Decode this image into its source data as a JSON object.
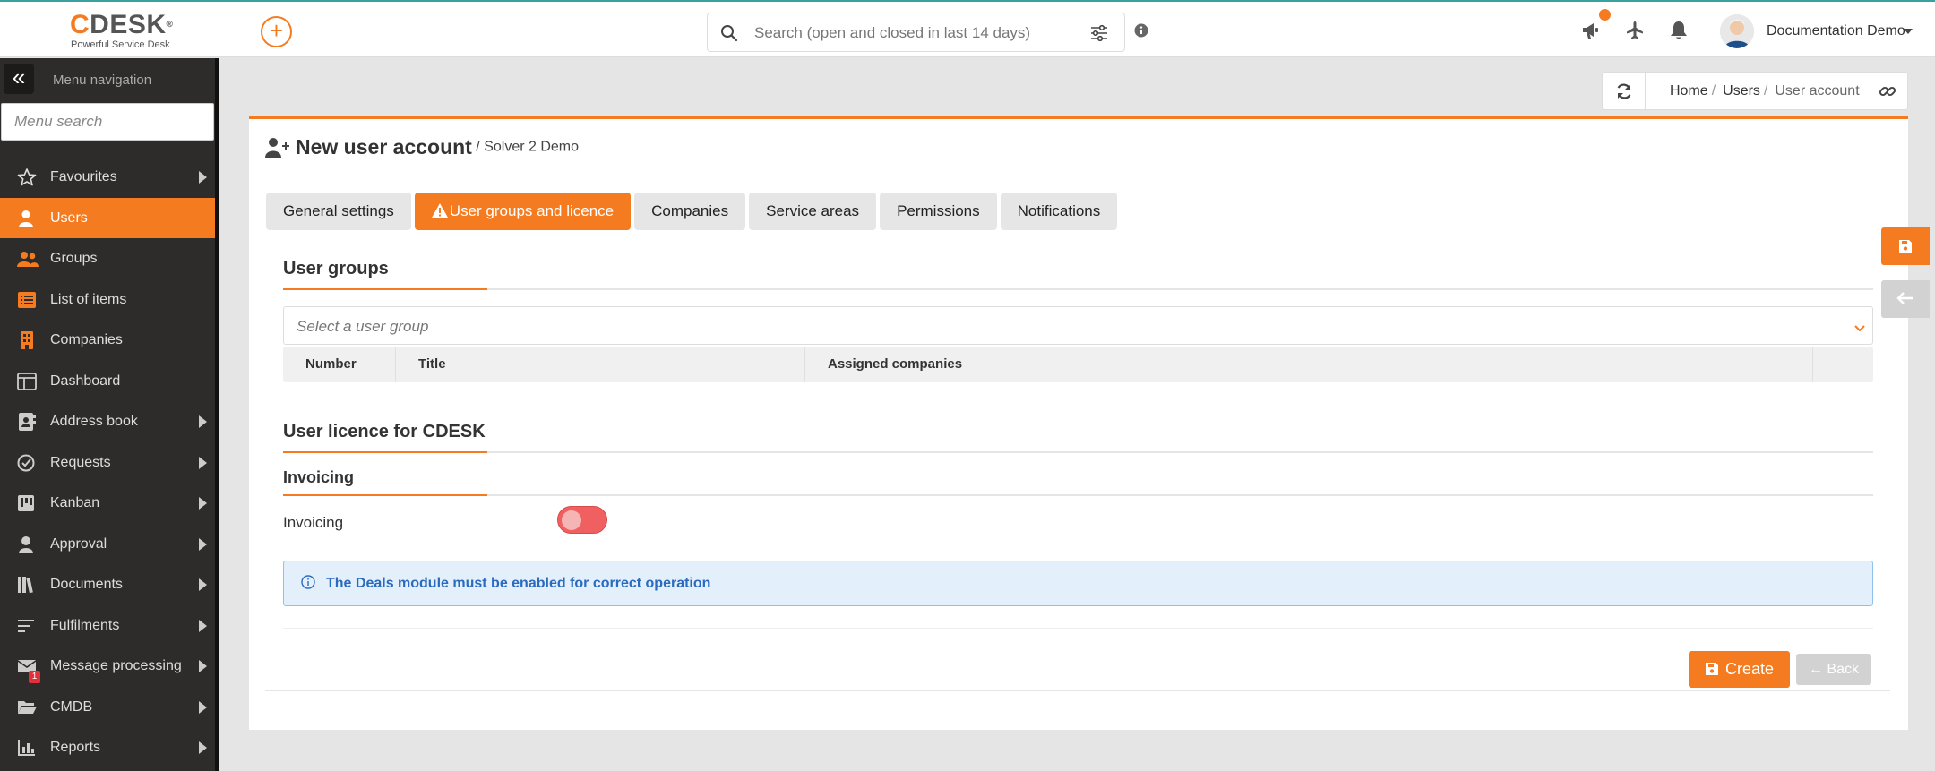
{
  "header": {
    "logo_first": "C",
    "logo_rest": "DESK",
    "logo_mark": "®",
    "logo_tagline": "Powerful Service Desk",
    "add_label": "+",
    "search_placeholder": "Search (open and closed in last 14 days)",
    "user_name": "Documentation Demo",
    "accent_color": "#f47b20"
  },
  "sidebar": {
    "collapse_label": "«",
    "title": "Menu navigation",
    "search_placeholder": "Menu search",
    "items": [
      {
        "label": "Favourites",
        "icon": "star-icon",
        "submenu": true
      },
      {
        "label": "Users",
        "icon": "user-icon",
        "active": true
      },
      {
        "label": "Groups",
        "icon": "groups-icon"
      },
      {
        "label": "List of items",
        "icon": "list-icon"
      },
      {
        "label": "Companies",
        "icon": "building-icon"
      },
      {
        "label": "Dashboard",
        "icon": "dashboard-icon"
      },
      {
        "label": "Address book",
        "icon": "address-book-icon",
        "submenu": true
      },
      {
        "label": "Requests",
        "icon": "requests-icon",
        "submenu": true
      },
      {
        "label": "Kanban",
        "icon": "kanban-icon",
        "submenu": true
      },
      {
        "label": "Approval",
        "icon": "approval-icon",
        "submenu": true
      },
      {
        "label": "Documents",
        "icon": "documents-icon",
        "submenu": true
      },
      {
        "label": "Fulfilments",
        "icon": "fulfilments-icon",
        "submenu": true
      },
      {
        "label": "Message processing",
        "icon": "envelope-icon",
        "submenu": true,
        "badge": "1"
      },
      {
        "label": "CMDB",
        "icon": "folder-icon",
        "submenu": true
      },
      {
        "label": "Reports",
        "icon": "chart-icon",
        "submenu": true
      }
    ]
  },
  "breadcrumb": {
    "items": [
      "Home",
      "Users",
      "User account"
    ],
    "separator": "/"
  },
  "page": {
    "title": "New user account",
    "subtitle": "/ Solver 2 Demo",
    "tabs": [
      {
        "label": "General settings"
      },
      {
        "label": "User groups and licence",
        "active": true,
        "warning": true
      },
      {
        "label": "Companies"
      },
      {
        "label": "Service areas"
      },
      {
        "label": "Permissions"
      },
      {
        "label": "Notifications"
      }
    ],
    "user_groups_heading": "User groups",
    "group_select_placeholder": "Select a user group",
    "group_columns": [
      "Number",
      "Title",
      "Assigned companies",
      ""
    ],
    "licence_heading": "User licence for CDESK",
    "invoicing_heading": "Invoicing",
    "invoicing_label": "Invoicing",
    "invoicing_enabled": false,
    "alert_text": "The Deals module must be enabled for correct operation",
    "create_label": "Create",
    "back_label": "← Back"
  }
}
